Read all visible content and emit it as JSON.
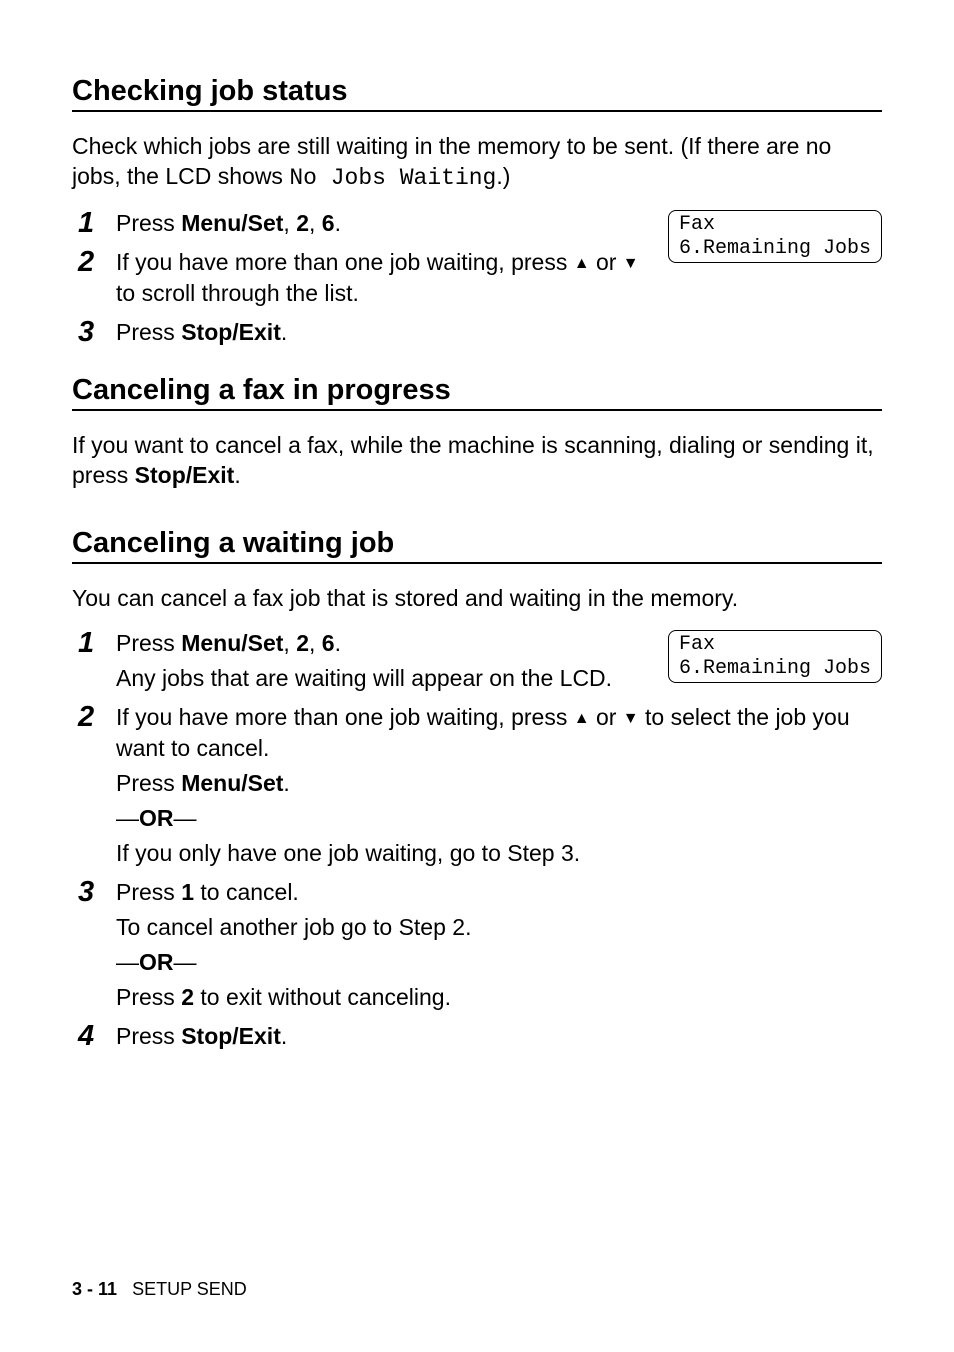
{
  "section1": {
    "title": "Checking job status",
    "intro_pre": "Check which jobs are still waiting in the memory to be sent. (If there are no jobs, the LCD shows ",
    "intro_mono": "No Jobs Waiting",
    "intro_post": ".)",
    "step1_pre": "Press ",
    "step1_b1": "Menu/Set",
    "step1_mid1": ", ",
    "step1_b2": "2",
    "step1_mid2": ", ",
    "step1_b3": "6",
    "step1_post": ".",
    "step2_pre": "If you have more than one job waiting, press ",
    "step2_mid": " or ",
    "step2_post": " to scroll through the list.",
    "step3_pre": "Press ",
    "step3_b": "Stop/Exit",
    "step3_post": ".",
    "lcd_l1": "Fax",
    "lcd_l2": "6.Remaining Jobs"
  },
  "section2": {
    "title": "Canceling a fax in progress",
    "body_pre": "If you want to cancel a fax, while the machine is scanning, dialing or sending it, press ",
    "body_b": "Stop/Exit",
    "body_post": "."
  },
  "section3": {
    "title": "Canceling a waiting job",
    "intro": "You can cancel a fax job that is stored and waiting in the memory.",
    "s1_pre": "Press ",
    "s1_b1": "Menu/Set",
    "s1_mid1": ", ",
    "s1_b2": "2",
    "s1_mid2": ", ",
    "s1_b3": "6",
    "s1_post": ".",
    "s1_line2": "Any jobs that are waiting will appear on the LCD.",
    "s2_pre": "If you have more than one job waiting, press ",
    "s2_mid": " or ",
    "s2_post": " to select the job you want to cancel.",
    "s2_l2_pre": "Press ",
    "s2_l2_b": "Menu/Set",
    "s2_l2_post": ".",
    "s2_l3_dash1": "—",
    "s2_l3_b": "OR",
    "s2_l3_dash2": "—",
    "s2_l4": "If you only have one job waiting, go to Step 3.",
    "s3_pre": "Press ",
    "s3_b": "1",
    "s3_post": " to cancel.",
    "s3_l2": "To cancel another job go to Step 2.",
    "s3_l3_dash1": "—",
    "s3_l3_b": "OR",
    "s3_l3_dash2": "—",
    "s3_l4_pre": "Press ",
    "s3_l4_b": "2",
    "s3_l4_post": " to exit without canceling.",
    "s4_pre": "Press ",
    "s4_b": "Stop/Exit",
    "s4_post": ".",
    "lcd_l1": "Fax",
    "lcd_l2": "6.Remaining Jobs"
  },
  "nums": {
    "n1": "1",
    "n2": "2",
    "n3": "3",
    "n4": "4"
  },
  "arrows": {
    "up": "▲",
    "down": "▼"
  },
  "footer": {
    "page": "3 - 11",
    "chapter": "SETUP SEND"
  }
}
